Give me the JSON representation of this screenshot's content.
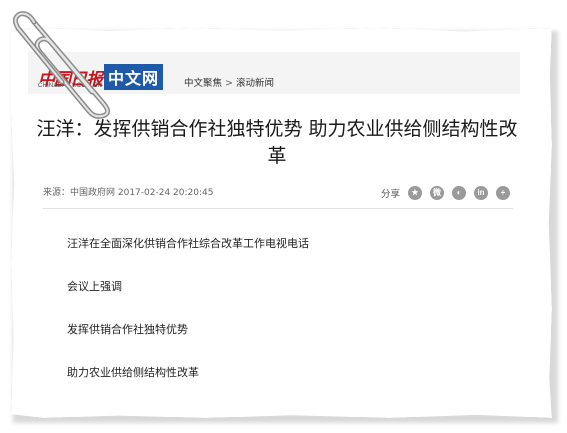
{
  "header": {
    "logo_cn": "中国日报",
    "logo_sub": "CHINADAILY.COM.CN",
    "logo_box": "中文网",
    "breadcrumb": [
      "中文聚焦",
      "滚动新闻"
    ],
    "breadcrumb_sep": ">"
  },
  "article": {
    "title": "汪洋：发挥供销合作社独特优势 助力农业供给侧结构性改革",
    "meta": "来源：中国政府网  2017-02-24 20:20:45",
    "paragraphs": [
      "汪洋在全面深化供销合作社综合改革工作电视电话",
      "会议上强调",
      "发挥供销合作社独特优势",
      "助力农业供给侧结构性改革"
    ]
  },
  "share": {
    "label": "分享",
    "icons": [
      {
        "name": "qzone-icon",
        "glyph": "★"
      },
      {
        "name": "weibo-icon",
        "glyph": "微"
      },
      {
        "name": "wechat-icon",
        "glyph": "◐"
      },
      {
        "name": "linkedin-icon",
        "glyph": "in"
      },
      {
        "name": "more-icon",
        "glyph": "+"
      }
    ]
  },
  "colors": {
    "logo_red": "#c8161d",
    "logo_blue": "#1e5aa8",
    "icon_gray": "#9a9a9a"
  }
}
